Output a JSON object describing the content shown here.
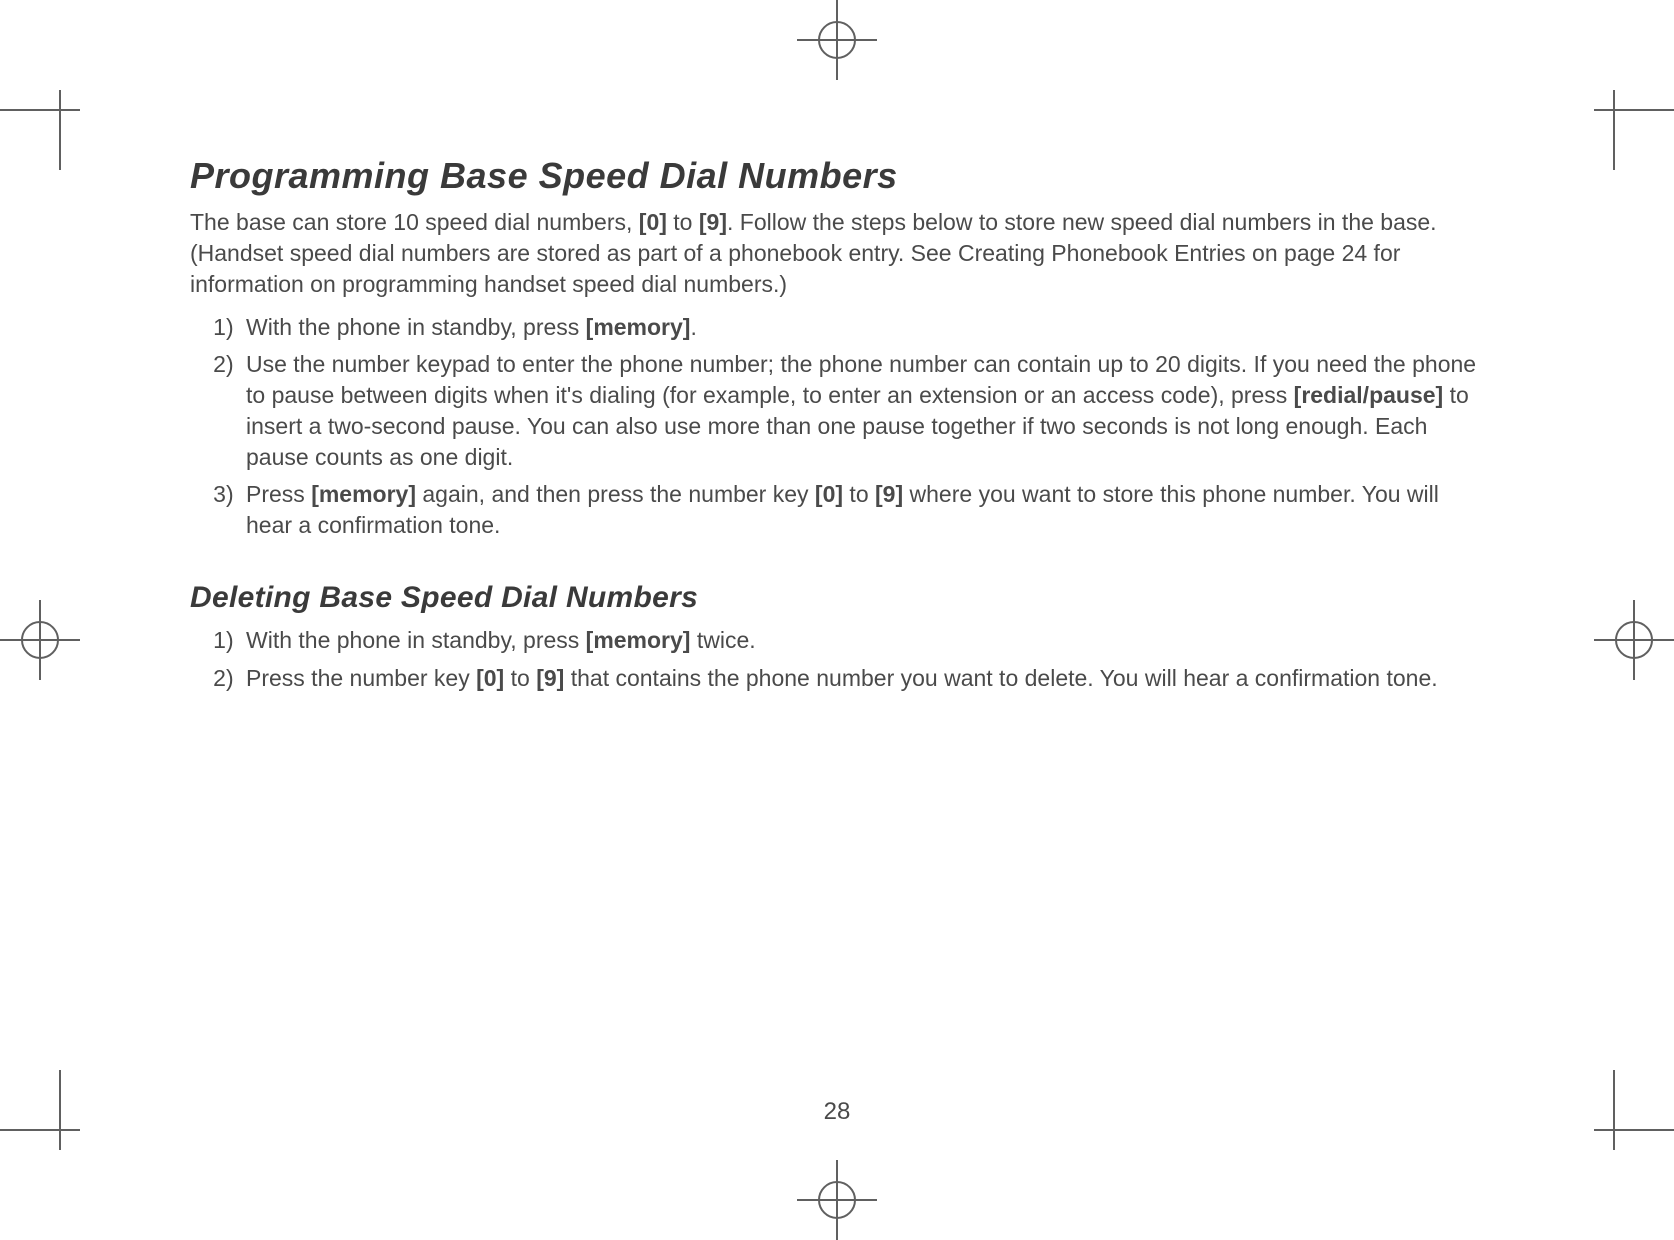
{
  "page_number": "28",
  "section1": {
    "heading": "Programming Base Speed Dial Numbers",
    "intro_pre": "The base can store 10 speed dial numbers, ",
    "intro_k0": "[0]",
    "intro_mid1": " to ",
    "intro_k9": "[9]",
    "intro_post": ". Follow the steps below to store new speed dial numbers in the base. (Handset speed dial numbers are stored as part of a phonebook entry. See Creating Phonebook Entries on page 24 for information on programming handset speed dial numbers.)",
    "steps": {
      "s1_pre": "With the phone in standby, press ",
      "s1_key": "[memory]",
      "s1_post": ".",
      "s2_pre": "Use the number keypad to enter the phone number; the phone number can contain up to 20 digits. If you need the phone to pause between digits when it's dialing (for example, to enter an extension or an access code), press ",
      "s2_key": "[redial/pause]",
      "s2_post": " to insert a two-second pause. You can also use more than one pause together if two seconds is not long enough. Each pause counts as one digit.",
      "s3_pre": "Press ",
      "s3_key1": "[memory]",
      "s3_mid1": " again, and then press the number key ",
      "s3_key2": "[0]",
      "s3_mid2": " to ",
      "s3_key3": "[9]",
      "s3_post": " where you want to store this phone number. You will hear a confirmation tone."
    }
  },
  "section2": {
    "heading": "Deleting Base Speed Dial Numbers",
    "steps": {
      "s1_pre": "With the phone in standby, press ",
      "s1_key": "[memory]",
      "s1_post": " twice.",
      "s2_pre": "Press the number key ",
      "s2_key1": "[0]",
      "s2_mid": " to ",
      "s2_key2": "[9]",
      "s2_post": " that contains the phone number you want to delete. You will hear a confirmation tone."
    }
  }
}
